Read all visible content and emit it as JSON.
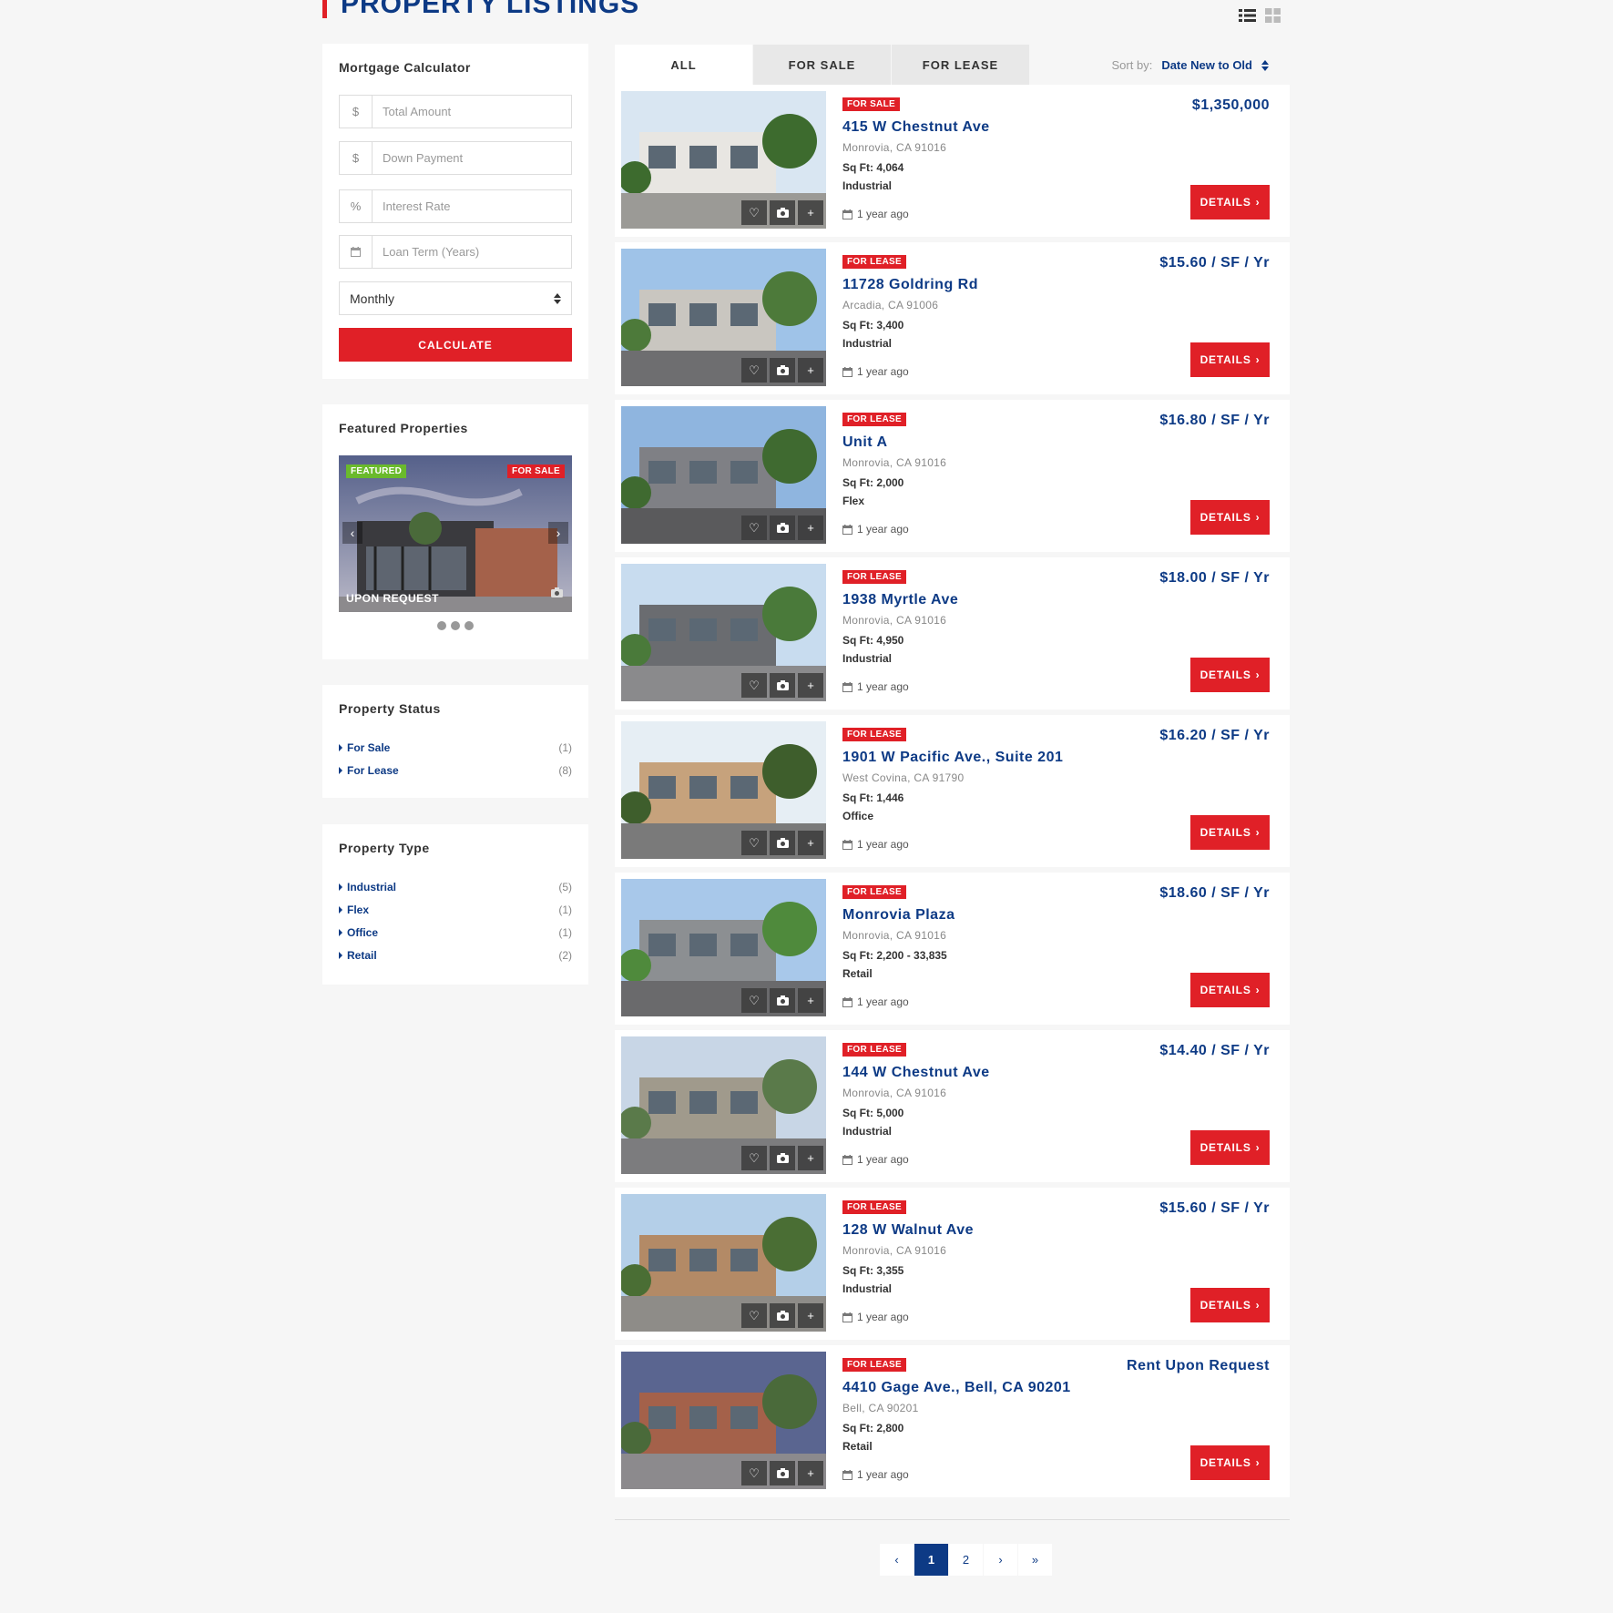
{
  "header": {
    "title": "PROPERTY LISTINGS"
  },
  "view_icons": [
    "list-view-icon",
    "grid-view-icon"
  ],
  "mortgage": {
    "title": "Mortgage Calculator",
    "fields": [
      {
        "addon": "$",
        "placeholder": "Total Amount"
      },
      {
        "addon": "$",
        "placeholder": "Down Payment"
      },
      {
        "addon": "%",
        "placeholder": "Interest Rate"
      },
      {
        "addon": "calendar-icon",
        "placeholder": "Loan Term (Years)"
      }
    ],
    "frequency": "Monthly",
    "button": "CALCULATE"
  },
  "featured": {
    "title": "Featured Properties",
    "badge_featured": "FEATURED",
    "badge_status": "FOR SALE",
    "price": "UPON REQUEST"
  },
  "status": {
    "title": "Property Status",
    "items": [
      {
        "label": "For Sale",
        "count": "(1)"
      },
      {
        "label": "For Lease",
        "count": "(8)"
      }
    ]
  },
  "types": {
    "title": "Property Type",
    "items": [
      {
        "label": "Industrial",
        "count": "(5)"
      },
      {
        "label": "Flex",
        "count": "(1)"
      },
      {
        "label": "Office",
        "count": "(1)"
      },
      {
        "label": "Retail",
        "count": "(2)"
      }
    ]
  },
  "tabs": [
    "ALL",
    "FOR SALE",
    "FOR LEASE"
  ],
  "sort": {
    "label": "Sort by:",
    "value": "Date New to Old"
  },
  "listings": [
    {
      "badge": "FOR SALE",
      "title": "415 W Chestnut Ave",
      "address": "Monrovia, CA 91016",
      "sqft": "Sq Ft: 4,064",
      "type": "Industrial",
      "date": "1 year ago",
      "price": "$1,350,000",
      "details": "DETAILS"
    },
    {
      "badge": "FOR LEASE",
      "title": "11728 Goldring Rd",
      "address": "Arcadia, CA 91006",
      "sqft": "Sq Ft: 3,400",
      "type": "Industrial",
      "date": "1 year ago",
      "price": "$15.60 / SF / Yr",
      "details": "DETAILS"
    },
    {
      "badge": "FOR LEASE",
      "title": "Unit A",
      "address": "Monrovia, CA 91016",
      "sqft": "Sq Ft: 2,000",
      "type": "Flex",
      "date": "1 year ago",
      "price": "$16.80 / SF / Yr",
      "details": "DETAILS"
    },
    {
      "badge": "FOR LEASE",
      "title": "1938 Myrtle Ave",
      "address": "Monrovia, CA 91016",
      "sqft": "Sq Ft: 4,950",
      "type": "Industrial",
      "date": "1 year ago",
      "price": "$18.00 / SF / Yr",
      "details": "DETAILS"
    },
    {
      "badge": "FOR LEASE",
      "title": "1901 W Pacific Ave., Suite 201",
      "address": "West Covina, CA 91790",
      "sqft": "Sq Ft: 1,446",
      "type": "Office",
      "date": "1 year ago",
      "price": "$16.20 / SF / Yr",
      "details": "DETAILS"
    },
    {
      "badge": "FOR LEASE",
      "title": "Monrovia Plaza",
      "address": "Monrovia, CA 91016",
      "sqft": "Sq Ft: 2,200 - 33,835",
      "type": "Retail",
      "date": "1 year ago",
      "price": "$18.60 / SF / Yr",
      "details": "DETAILS"
    },
    {
      "badge": "FOR LEASE",
      "title": "144 W Chestnut Ave",
      "address": "Monrovia, CA 91016",
      "sqft": "Sq Ft: 5,000",
      "type": "Industrial",
      "date": "1 year ago",
      "price": "$14.40 / SF / Yr",
      "details": "DETAILS"
    },
    {
      "badge": "FOR LEASE",
      "title": "128 W Walnut Ave",
      "address": "Monrovia, CA 91016",
      "sqft": "Sq Ft: 3,355",
      "type": "Industrial",
      "date": "1 year ago",
      "price": "$15.60 / SF / Yr",
      "details": "DETAILS"
    },
    {
      "badge": "FOR LEASE",
      "title": "4410 Gage Ave., Bell, CA 90201",
      "address": "Bell, CA 90201",
      "sqft": "Sq Ft: 2,800",
      "type": "Retail",
      "date": "1 year ago",
      "price": "Rent Upon Request",
      "details": "DETAILS"
    }
  ],
  "pagination": {
    "prev": "‹",
    "pages": [
      "1",
      "2"
    ],
    "active": "1",
    "next": "›",
    "last": "»"
  },
  "colors": {
    "primary": "#0d3a85",
    "accent": "#e02027",
    "featured": "#6aba2c"
  }
}
